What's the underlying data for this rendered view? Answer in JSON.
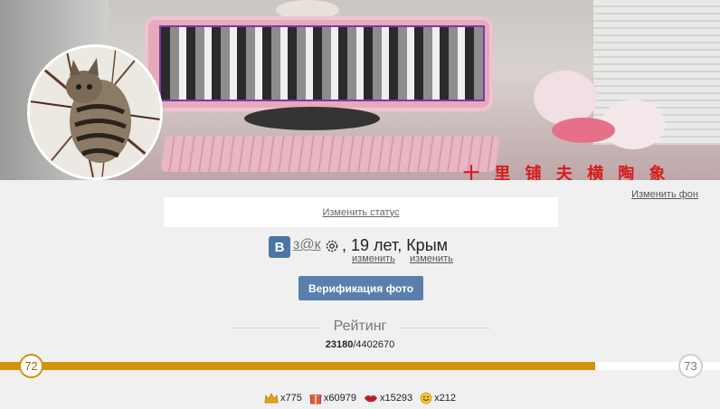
{
  "cover": {
    "caption": "十 里 铺 夫 横 陶 象",
    "change_label": "Изменить фон"
  },
  "status": {
    "change_label": "Изменить статус"
  },
  "profile": {
    "network_badge": "В",
    "username": "з@к",
    "info": ", 19 лет, Крым",
    "edit_age_label": "изменить",
    "edit_city_label": "изменить"
  },
  "verify": {
    "label": "Верификация фото"
  },
  "rating": {
    "title": "Рейтинг",
    "score": "23180",
    "separator": "/",
    "total": "4402670",
    "current_level": "72",
    "next_level": "73",
    "progress_percent": 82.7
  },
  "stats": [
    {
      "icon": "crown-icon",
      "value": "x775"
    },
    {
      "icon": "gift-icon",
      "value": "x60979"
    },
    {
      "icon": "lips-icon",
      "value": "x15293"
    },
    {
      "icon": "smiley-icon",
      "value": "x212"
    }
  ],
  "colors": {
    "accent": "#d4920c",
    "button": "#5b7fac",
    "vk_blue": "#4c75a3"
  }
}
